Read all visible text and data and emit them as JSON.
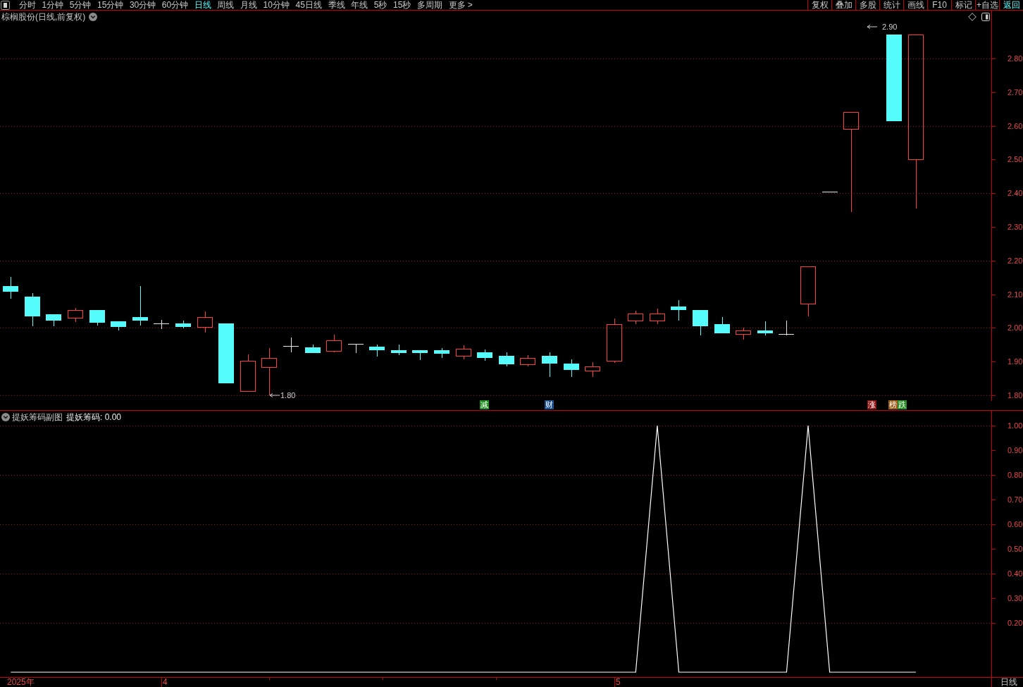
{
  "toolbar": {
    "periods": [
      {
        "label": "分时",
        "selected": false
      },
      {
        "label": "1分钟",
        "selected": false
      },
      {
        "label": "5分钟",
        "selected": false
      },
      {
        "label": "15分钟",
        "selected": false
      },
      {
        "label": "30分钟",
        "selected": false
      },
      {
        "label": "60分钟",
        "selected": false
      },
      {
        "label": "日线",
        "selected": true
      },
      {
        "label": "周线",
        "selected": false
      },
      {
        "label": "月线",
        "selected": false
      },
      {
        "label": "10分钟",
        "selected": false
      },
      {
        "label": "45日线",
        "selected": false
      },
      {
        "label": "季线",
        "selected": false
      },
      {
        "label": "年线",
        "selected": false
      },
      {
        "label": "5秒",
        "selected": false
      },
      {
        "label": "15秒",
        "selected": false
      },
      {
        "label": "多周期",
        "selected": false
      },
      {
        "label": "更多 >",
        "selected": false
      }
    ],
    "actions": [
      {
        "label": "复权",
        "highlighted": false
      },
      {
        "label": "叠加",
        "highlighted": false
      },
      {
        "label": "多股",
        "highlighted": false
      },
      {
        "label": "统计",
        "highlighted": false
      },
      {
        "label": "画线",
        "highlighted": false
      },
      {
        "label": "F10",
        "highlighted": false
      },
      {
        "label": "标记",
        "highlighted": false
      },
      {
        "label": "+自选",
        "highlighted": false
      },
      {
        "label": "返回",
        "highlighted": true
      }
    ]
  },
  "price_chart": {
    "title": "棕榈股份(日线,前复权)",
    "axis_labels": [
      "2.80",
      "2.70",
      "2.60",
      "2.50",
      "2.40",
      "2.30",
      "2.20",
      "2.10",
      "2.00",
      "1.90",
      "1.80"
    ],
    "high_label": "2.90",
    "low_label": "1.80",
    "event_tags": [
      {
        "label": "减",
        "color": "#1e8c1e"
      },
      {
        "label": "财",
        "color": "#1c4f8f"
      },
      {
        "label": "涨",
        "color": "#8c1010"
      },
      {
        "label": "榜",
        "color": "#9c5a16"
      },
      {
        "label": "跌",
        "color": "#238c23"
      }
    ]
  },
  "indicator": {
    "title": "提妖筹码副图",
    "legend": "提妖筹码: 0.00",
    "chart_data": {
      "type": "line",
      "series": [
        {
          "color": "#ffffff",
          "values": [
            0,
            0,
            0,
            0,
            0,
            0,
            0,
            0,
            0,
            0,
            0,
            0,
            0,
            0,
            0,
            0,
            0,
            0,
            0,
            0,
            0,
            0,
            0,
            0,
            0,
            0,
            0,
            0,
            0,
            0,
            1,
            0,
            0,
            0,
            0,
            0,
            0,
            1,
            0,
            0,
            0,
            0,
            0,
            null,
            null,
            null
          ]
        }
      ],
      "ylim": [
        -0.02,
        1.06
      ],
      "yticks": [
        {
          "value": 0.2,
          "label": "0.20"
        },
        {
          "value": 0.3,
          "label": "0.30"
        },
        {
          "value": 0.4,
          "label": "0.40"
        },
        {
          "value": 0.5,
          "label": "0.50"
        },
        {
          "value": 0.6,
          "label": "0.60"
        },
        {
          "value": 0.7,
          "label": "0.70"
        },
        {
          "value": 0.8,
          "label": "0.80"
        },
        {
          "value": 0.9,
          "label": "0.90"
        },
        {
          "value": 1.0,
          "label": "1.00"
        }
      ],
      "grid": true
    }
  },
  "date_axis": {
    "labels": [
      "2025年",
      "4",
      "5"
    ],
    "period": "日线"
  }
}
